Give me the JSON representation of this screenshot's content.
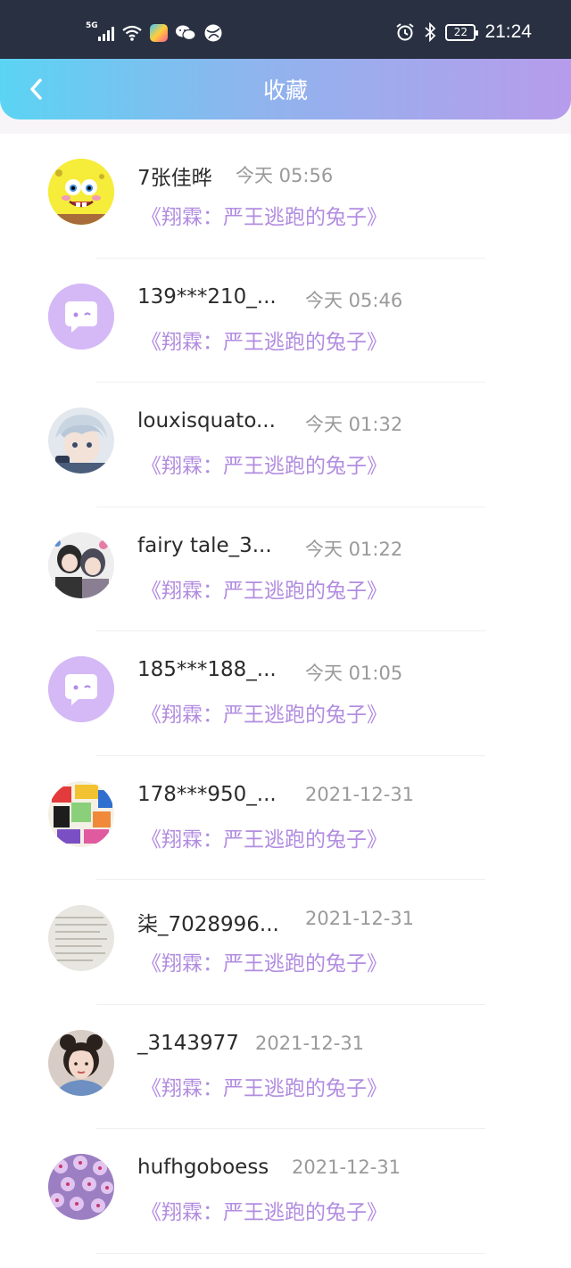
{
  "status_bar": {
    "network": "5G",
    "battery": "22",
    "time": "21:24"
  },
  "header": {
    "title": "收藏"
  },
  "list": [
    {
      "name": "7张佳晔",
      "time": "今天 05:56",
      "work": "《翔霖：严王逃跑的兔子》",
      "avatar": "spongebob-avatar"
    },
    {
      "name": "139***210_...",
      "time": "今天 05:46",
      "work": "《翔霖：严王逃跑的兔子》",
      "avatar": "default-avatar"
    },
    {
      "name": "louxisquato...",
      "time": "今天 01:32",
      "work": "《翔霖：严王逃跑的兔子》",
      "avatar": "anime-avatar"
    },
    {
      "name": "fairy tale_3...",
      "time": "今天 01:22",
      "work": "《翔霖：严王逃跑的兔子》",
      "avatar": "anime-group-avatar"
    },
    {
      "name": "185***188_...",
      "time": "今天 01:05",
      "work": "《翔霖：严王逃跑的兔子》",
      "avatar": "default-avatar"
    },
    {
      "name": "178***950_...",
      "time": "2021-12-31",
      "work": "《翔霖：严王逃跑的兔子》",
      "avatar": "collage-avatar"
    },
    {
      "name": "柒_7028996...",
      "time": "2021-12-31",
      "work": "《翔霖：严王逃跑的兔子》",
      "avatar": "paper-avatar"
    },
    {
      "name": "_3143977",
      "time": "2021-12-31",
      "work": "《翔霖：严王逃跑的兔子》",
      "avatar": "portrait-avatar"
    },
    {
      "name": "hufhgoboess",
      "time": "2021-12-31",
      "work": "《翔霖：严王逃跑的兔子》",
      "avatar": "flowers-avatar"
    }
  ],
  "colors": {
    "accent_purple": "#b28de0",
    "gradient_start": "#5bd4f3",
    "gradient_end": "#b79cec"
  }
}
